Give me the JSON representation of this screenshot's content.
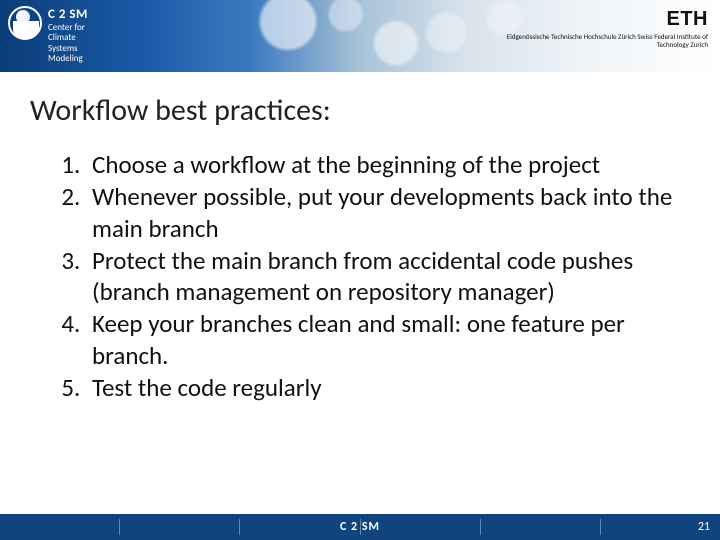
{
  "header": {
    "left_logo": {
      "acronym": "C 2 SM",
      "line1": "Center for Climate",
      "line2": "Systems Modeling"
    },
    "right_logo": {
      "name": "ETH",
      "subline": "Eidgenössische Technische Hochschule Zürich\nSwiss Federal Institute of Technology Zurich"
    }
  },
  "title": "Workflow best practices:",
  "items": [
    "Choose a workflow at the beginning of the project",
    "Whenever possible, put your developments back into the main branch",
    "Protect the main branch from accidental code pushes (branch management on repository manager)",
    "Keep your branches clean and small: one feature per branch.",
    "Test the code regularly"
  ],
  "footer": {
    "center": "C 2 SM",
    "page": "21"
  }
}
